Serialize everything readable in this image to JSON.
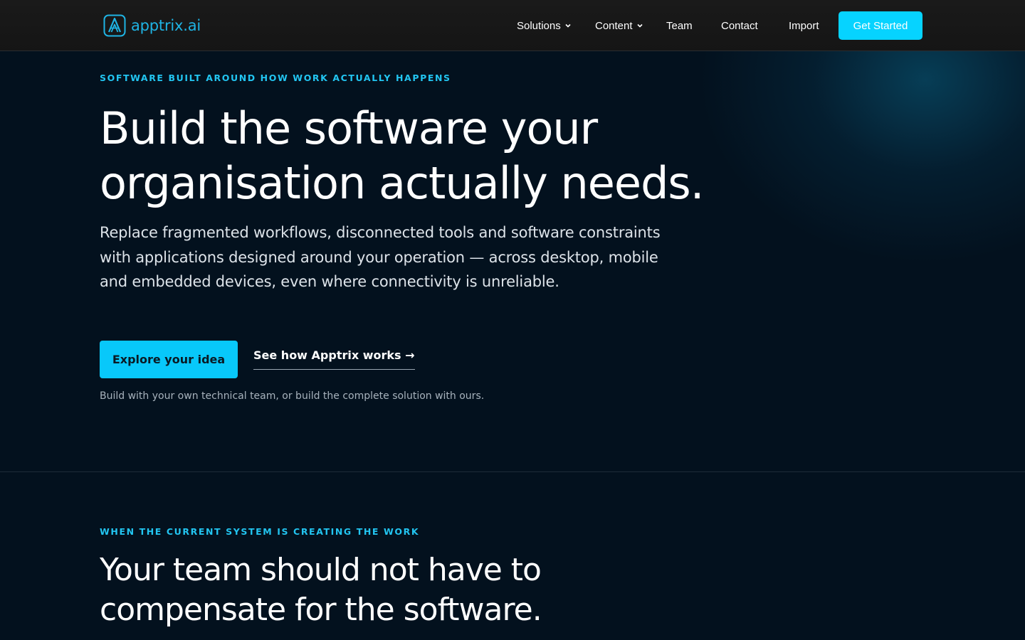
{
  "brand": {
    "name": "apptrix.ai",
    "color": "#1fb4e4"
  },
  "nav": {
    "items": [
      {
        "label": "Solutions",
        "has_dropdown": true
      },
      {
        "label": "Content",
        "has_dropdown": true
      },
      {
        "label": "Team",
        "has_dropdown": false
      },
      {
        "label": "Contact",
        "has_dropdown": false
      },
      {
        "label": "Import",
        "has_dropdown": false
      }
    ],
    "cta_label": "Get Started",
    "cta_color": "#06d3ff"
  },
  "hero": {
    "eyebrow": "SOFTWARE BUILT AROUND HOW WORK ACTUALLY HAPPENS",
    "headline_line1": "Build the software your",
    "headline_line2": "organisation actually needs.",
    "lede": "Replace fragmented workflows, disconnected tools and software constraints with applications designed around your operation — across desktop, mobile and embedded devices, even where connectivity is unreliable.",
    "primary_button": "Explore your idea",
    "secondary_link": "See how Apptrix works →",
    "note": "Build with your own technical team, or build the complete solution with ours.",
    "accent_color": "#22c5f1"
  },
  "section2": {
    "eyebrow": "WHEN THE CURRENT SYSTEM IS CREATING THE WORK",
    "headline_line1": "Your team should not have to",
    "headline_line2": "compensate for the software."
  },
  "icons": {
    "logo": "apptrix-logo-icon",
    "dropdown": "chevron-down-icon"
  }
}
